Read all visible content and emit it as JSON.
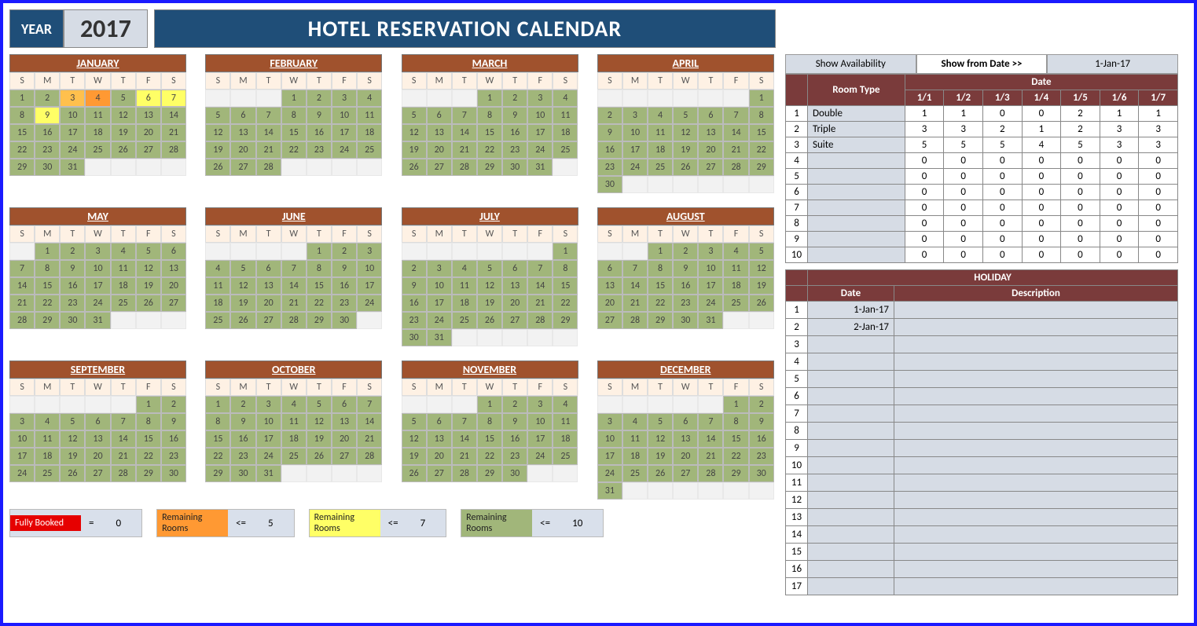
{
  "header": {
    "year_label": "YEAR",
    "year": "2017",
    "title": "HOTEL RESERVATION CALENDAR"
  },
  "dow": [
    "S",
    "M",
    "T",
    "W",
    "T",
    "F",
    "S"
  ],
  "months": [
    {
      "name": "JANUARY",
      "start": 0,
      "days": 31,
      "highlights": {
        "3": "hot1",
        "4": "hot2",
        "6": "hot3",
        "7": "hot3",
        "9": "hot3"
      }
    },
    {
      "name": "FEBRUARY",
      "start": 3,
      "days": 28,
      "highlights": {}
    },
    {
      "name": "MARCH",
      "start": 3,
      "days": 31,
      "highlights": {}
    },
    {
      "name": "APRIL",
      "start": 6,
      "days": 30,
      "highlights": {}
    },
    {
      "name": "MAY",
      "start": 1,
      "days": 31,
      "highlights": {}
    },
    {
      "name": "JUNE",
      "start": 4,
      "days": 30,
      "highlights": {}
    },
    {
      "name": "JULY",
      "start": 6,
      "days": 31,
      "highlights": {}
    },
    {
      "name": "AUGUST",
      "start": 2,
      "days": 31,
      "highlights": {}
    },
    {
      "name": "SEPTEMBER",
      "start": 5,
      "days": 30,
      "highlights": {}
    },
    {
      "name": "OCTOBER",
      "start": 0,
      "days": 31,
      "highlights": {}
    },
    {
      "name": "NOVEMBER",
      "start": 3,
      "days": 30,
      "highlights": {}
    },
    {
      "name": "DECEMBER",
      "start": 5,
      "days": 31,
      "highlights": {}
    }
  ],
  "legend": [
    {
      "label": "Fully Booked",
      "op": "=",
      "val": "0",
      "cls": "sw-red"
    },
    {
      "label": "Remaining Rooms",
      "op": "<=",
      "val": "5",
      "cls": "sw-orange"
    },
    {
      "label": "Remaining Rooms",
      "op": "<=",
      "val": "7",
      "cls": "sw-yellow"
    },
    {
      "label": "Remaining Rooms",
      "op": "<=",
      "val": "10",
      "cls": "sw-green"
    }
  ],
  "avail": {
    "btn1": "Show Availability",
    "btn2": "Show from Date >>",
    "date": "1-Jan-17",
    "room_type_label": "Room Type",
    "date_hdr": "Date",
    "cols": [
      "1/1",
      "1/2",
      "1/3",
      "1/4",
      "1/5",
      "1/6",
      "1/7"
    ],
    "rows": [
      {
        "n": 1,
        "type": "Double",
        "vals": [
          1,
          1,
          0,
          0,
          2,
          1,
          1
        ]
      },
      {
        "n": 2,
        "type": "Triple",
        "vals": [
          3,
          3,
          2,
          1,
          2,
          3,
          3
        ]
      },
      {
        "n": 3,
        "type": "Suite",
        "vals": [
          5,
          5,
          5,
          4,
          5,
          3,
          3
        ]
      },
      {
        "n": 4,
        "type": "",
        "vals": [
          0,
          0,
          0,
          0,
          0,
          0,
          0
        ]
      },
      {
        "n": 5,
        "type": "",
        "vals": [
          0,
          0,
          0,
          0,
          0,
          0,
          0
        ]
      },
      {
        "n": 6,
        "type": "",
        "vals": [
          0,
          0,
          0,
          0,
          0,
          0,
          0
        ]
      },
      {
        "n": 7,
        "type": "",
        "vals": [
          0,
          0,
          0,
          0,
          0,
          0,
          0
        ]
      },
      {
        "n": 8,
        "type": "",
        "vals": [
          0,
          0,
          0,
          0,
          0,
          0,
          0
        ]
      },
      {
        "n": 9,
        "type": "",
        "vals": [
          0,
          0,
          0,
          0,
          0,
          0,
          0
        ]
      },
      {
        "n": 10,
        "type": "",
        "vals": [
          0,
          0,
          0,
          0,
          0,
          0,
          0
        ]
      }
    ]
  },
  "holiday": {
    "title": "HOLIDAY",
    "date_h": "Date",
    "desc_h": "Description",
    "rows": [
      {
        "n": 1,
        "date": "1-Jan-17",
        "desc": ""
      },
      {
        "n": 2,
        "date": "2-Jan-17",
        "desc": ""
      },
      {
        "n": 3,
        "date": "",
        "desc": ""
      },
      {
        "n": 4,
        "date": "",
        "desc": ""
      },
      {
        "n": 5,
        "date": "",
        "desc": ""
      },
      {
        "n": 6,
        "date": "",
        "desc": ""
      },
      {
        "n": 7,
        "date": "",
        "desc": ""
      },
      {
        "n": 8,
        "date": "",
        "desc": ""
      },
      {
        "n": 9,
        "date": "",
        "desc": ""
      },
      {
        "n": 10,
        "date": "",
        "desc": ""
      },
      {
        "n": 11,
        "date": "",
        "desc": ""
      },
      {
        "n": 12,
        "date": "",
        "desc": ""
      },
      {
        "n": 13,
        "date": "",
        "desc": ""
      },
      {
        "n": 14,
        "date": "",
        "desc": ""
      },
      {
        "n": 15,
        "date": "",
        "desc": ""
      },
      {
        "n": 16,
        "date": "",
        "desc": ""
      },
      {
        "n": 17,
        "date": "",
        "desc": ""
      }
    ]
  }
}
